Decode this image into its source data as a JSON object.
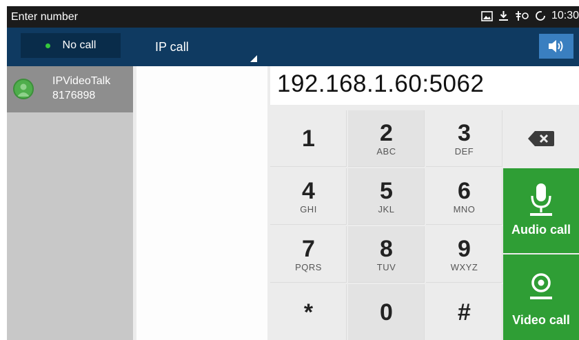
{
  "status_bar": {
    "title": "Enter number",
    "time": "10:30",
    "icons": [
      "gallery-icon",
      "download-icon",
      "usb-debug-icon",
      "sync-icon"
    ]
  },
  "top_bar": {
    "call_status": "No call",
    "call_type": "IP call",
    "speaker_icon": "speaker-icon"
  },
  "contacts": [
    {
      "name": "IPVideoTalk",
      "number": "8176898"
    }
  ],
  "dialer": {
    "entered_number": "192.168.1.60:5062",
    "keys": [
      {
        "digit": "1",
        "letters": ""
      },
      {
        "digit": "2",
        "letters": "ABC"
      },
      {
        "digit": "3",
        "letters": "DEF"
      },
      {
        "digit": "4",
        "letters": "GHI"
      },
      {
        "digit": "5",
        "letters": "JKL"
      },
      {
        "digit": "6",
        "letters": "MNO"
      },
      {
        "digit": "7",
        "letters": "PQRS"
      },
      {
        "digit": "8",
        "letters": "TUV"
      },
      {
        "digit": "9",
        "letters": "WXYZ"
      },
      {
        "digit": "*",
        "letters": ""
      },
      {
        "digit": "0",
        "letters": ""
      },
      {
        "digit": "#",
        "letters": ""
      }
    ]
  },
  "actions": {
    "audio_call": "Audio call",
    "video_call": "Video call"
  },
  "colors": {
    "status_bar": "#1b1b1b",
    "top_bar": "#0f3a61",
    "call_green": "#2f9e35",
    "speaker_blue": "#3a7fc0",
    "status_dot": "#35c83c"
  }
}
